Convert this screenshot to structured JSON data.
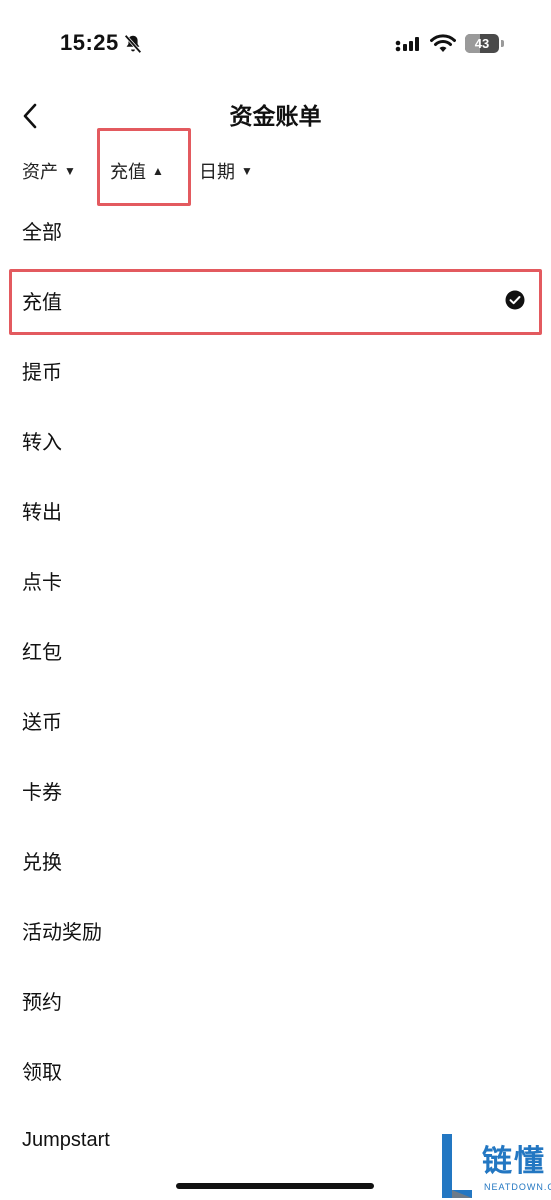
{
  "status_bar": {
    "time": "15:25",
    "battery_level": "43",
    "battery_percent": 43
  },
  "header": {
    "title": "资金账单"
  },
  "filters": [
    {
      "label": "资产",
      "arrow": "down"
    },
    {
      "label": "充值",
      "arrow": "up"
    },
    {
      "label": "日期",
      "arrow": "down"
    }
  ],
  "options": [
    {
      "label": "全部"
    },
    {
      "label": "充值",
      "selected": true
    },
    {
      "label": "提币"
    },
    {
      "label": "转入"
    },
    {
      "label": "转出"
    },
    {
      "label": "点卡"
    },
    {
      "label": "红包"
    },
    {
      "label": "送币"
    },
    {
      "label": "卡券"
    },
    {
      "label": "兑换"
    },
    {
      "label": "活动奖励"
    },
    {
      "label": "预约"
    },
    {
      "label": "领取"
    },
    {
      "label": "Jumpstart"
    }
  ],
  "watermark": {
    "text": "链懂",
    "subtext": "NEATDOWN.COM"
  },
  "colors": {
    "highlight": "#e35a5f",
    "watermark_blue": "#2377c2"
  }
}
